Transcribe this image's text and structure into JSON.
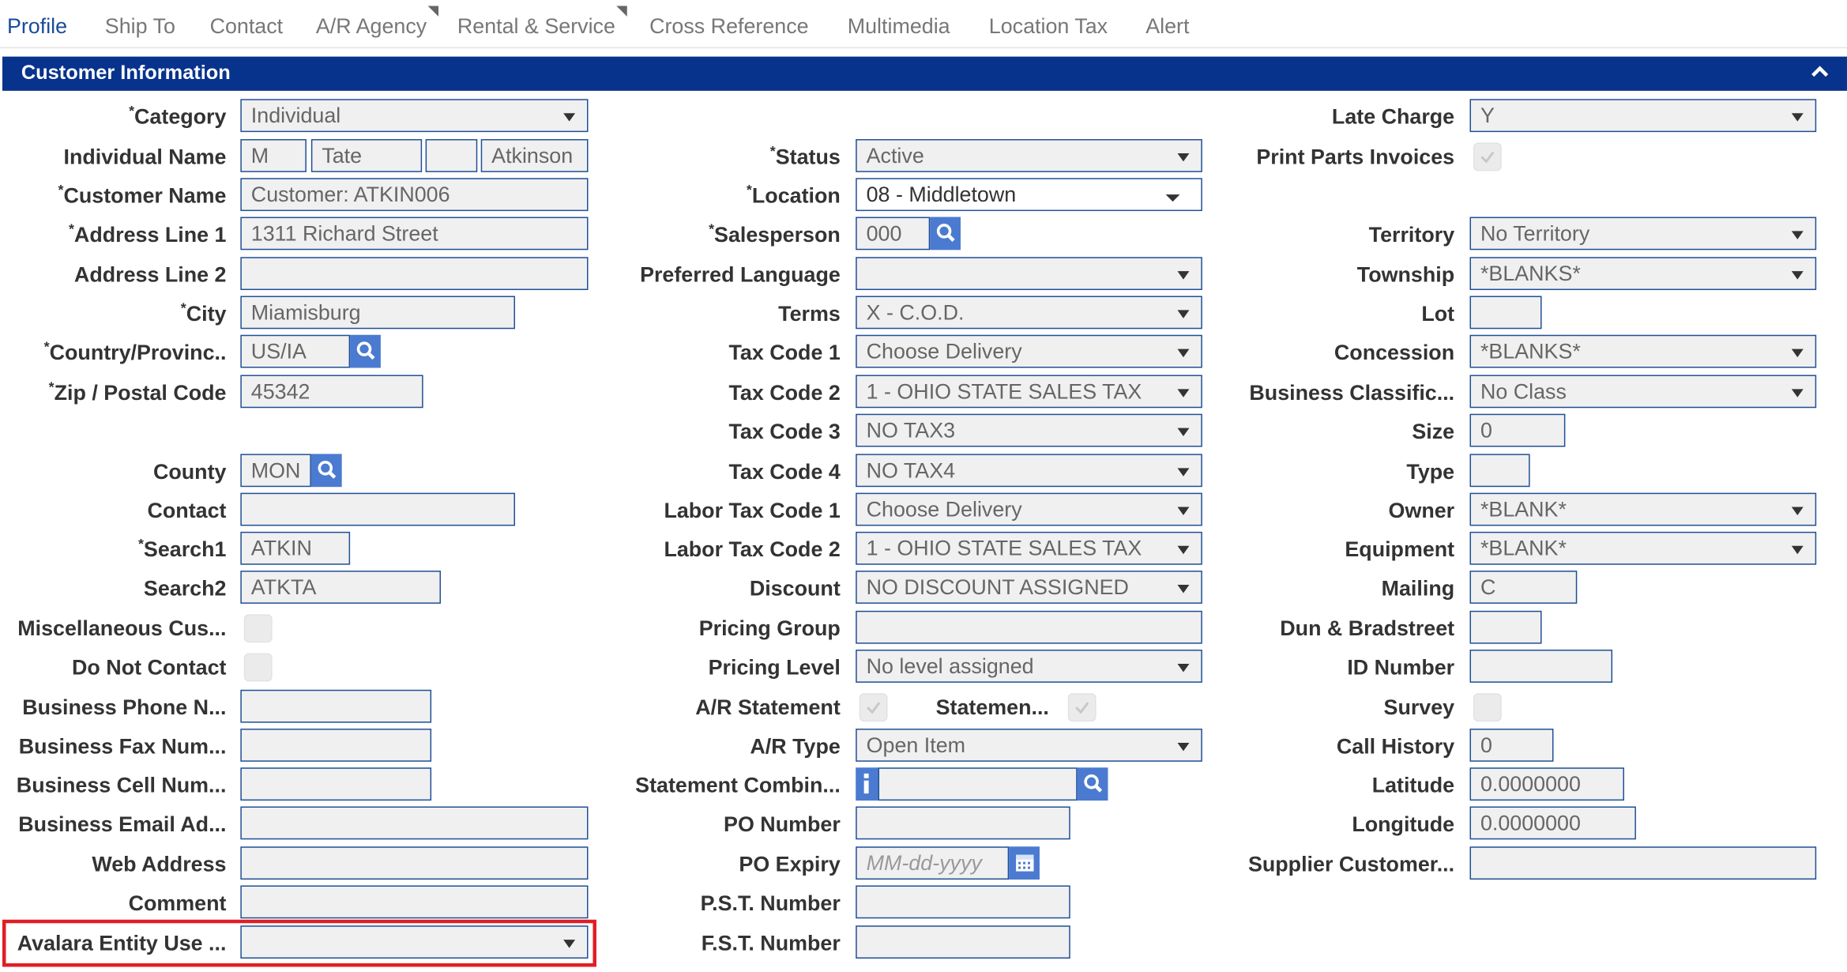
{
  "tabs": [
    {
      "label": "Profile",
      "active": true
    },
    {
      "label": "Ship To"
    },
    {
      "label": "Contact"
    },
    {
      "label": "A/R Agency",
      "dropdown": true
    },
    {
      "label": "Rental & Service",
      "dropdown": true
    },
    {
      "label": "Cross Reference"
    },
    {
      "label": "Multimedia"
    },
    {
      "label": "Location Tax"
    },
    {
      "label": "Alert"
    }
  ],
  "section": {
    "title": "Customer Information",
    "collapse_icon": "chevron-up-icon"
  },
  "left": {
    "category": {
      "label": "Category",
      "value": "Individual"
    },
    "individual_name": {
      "label": "Individual Name",
      "prefix": "M",
      "first": "Tate",
      "middle": "",
      "last": "Atkinson"
    },
    "customer_name": {
      "label": "Customer Name",
      "value": "Customer: ATKIN006"
    },
    "address1": {
      "label": "Address Line 1",
      "value": "1311 Richard Street"
    },
    "address2": {
      "label": "Address Line 2",
      "value": ""
    },
    "city": {
      "label": "City",
      "value": "Miamisburg"
    },
    "country": {
      "label": "Country/Provinc..",
      "value": "US/IA"
    },
    "zip": {
      "label": "Zip / Postal Code",
      "value": "45342"
    },
    "county": {
      "label": "County",
      "value": "MON"
    },
    "contact": {
      "label": "Contact",
      "value": ""
    },
    "search1": {
      "label": "Search1",
      "value": "ATKIN"
    },
    "search2": {
      "label": "Search2",
      "value": "ATKTA"
    },
    "misc": {
      "label": "Miscellaneous Cus..."
    },
    "dnc": {
      "label": "Do Not Contact"
    },
    "bphone": {
      "label": "Business Phone N...",
      "value": ""
    },
    "bfax": {
      "label": "Business Fax Num...",
      "value": ""
    },
    "bcell": {
      "label": "Business Cell Num...",
      "value": ""
    },
    "bemail": {
      "label": "Business Email Ad...",
      "value": ""
    },
    "web": {
      "label": "Web Address",
      "value": ""
    },
    "comment": {
      "label": "Comment",
      "value": ""
    },
    "avalara": {
      "label": "Avalara Entity Use ...",
      "value": ""
    }
  },
  "mid": {
    "status": {
      "label": "Status",
      "value": "Active"
    },
    "location": {
      "label": "Location",
      "value": "08 - Middletown"
    },
    "salesperson": {
      "label": "Salesperson",
      "value": "000"
    },
    "pref_lang": {
      "label": "Preferred Language",
      "value": ""
    },
    "terms": {
      "label": "Terms",
      "value": "X - C.O.D."
    },
    "tax1": {
      "label": "Tax Code 1",
      "value": "Choose Delivery"
    },
    "tax2": {
      "label": "Tax Code 2",
      "value": "1 - OHIO STATE SALES TAX"
    },
    "tax3": {
      "label": "Tax Code 3",
      "value": "NO TAX3"
    },
    "tax4": {
      "label": "Tax Code 4",
      "value": "NO TAX4"
    },
    "labor1": {
      "label": "Labor Tax Code 1",
      "value": "Choose Delivery"
    },
    "labor2": {
      "label": "Labor Tax Code 2",
      "value": "1 - OHIO STATE SALES TAX"
    },
    "discount": {
      "label": "Discount",
      "value": "NO DISCOUNT ASSIGNED"
    },
    "pricing_group": {
      "label": "Pricing Group",
      "value": ""
    },
    "pricing_level": {
      "label": "Pricing Level",
      "value": "No level assigned"
    },
    "ar_statement": {
      "label": "A/R Statement",
      "checked": true
    },
    "statement": {
      "label": "Statemen...",
      "checked": true
    },
    "ar_type": {
      "label": "A/R Type",
      "value": "Open Item"
    },
    "stmt_combine": {
      "label": "Statement Combin...",
      "value": ""
    },
    "po_number": {
      "label": "PO Number",
      "value": ""
    },
    "po_expiry": {
      "label": "PO Expiry",
      "placeholder": "MM-dd-yyyy"
    },
    "pst": {
      "label": "P.S.T. Number",
      "value": ""
    },
    "fst": {
      "label": "F.S.T. Number",
      "value": ""
    }
  },
  "right": {
    "late_charge": {
      "label": "Late Charge",
      "value": "Y"
    },
    "print_parts": {
      "label": "Print Parts Invoices",
      "checked": true
    },
    "territory": {
      "label": "Territory",
      "value": "No Territory"
    },
    "township": {
      "label": "Township",
      "value": "*BLANKS*"
    },
    "lot": {
      "label": "Lot",
      "value": ""
    },
    "concession": {
      "label": "Concession",
      "value": "*BLANKS*"
    },
    "bclass": {
      "label": "Business Classific...",
      "value": "No Class"
    },
    "size": {
      "label": "Size",
      "value": "0"
    },
    "type": {
      "label": "Type",
      "value": ""
    },
    "owner": {
      "label": "Owner",
      "value": "*BLANK*"
    },
    "equipment": {
      "label": "Equipment",
      "value": "*BLANK*"
    },
    "mailing": {
      "label": "Mailing",
      "value": "C"
    },
    "dnb": {
      "label": "Dun & Bradstreet",
      "value": ""
    },
    "idnum": {
      "label": "ID Number",
      "value": ""
    },
    "survey": {
      "label": "Survey",
      "checked": false
    },
    "call_history": {
      "label": "Call History",
      "value": "0"
    },
    "latitude": {
      "label": "Latitude",
      "value": "0.0000000"
    },
    "longitude": {
      "label": "Longitude",
      "value": "0.0000000"
    },
    "supplier": {
      "label": "Supplier Customer...",
      "value": ""
    }
  },
  "colors": {
    "header": "#08338c",
    "accent": "#1a4b9b",
    "icon_button": "#4b7bd0",
    "highlight": "#e01e25"
  }
}
